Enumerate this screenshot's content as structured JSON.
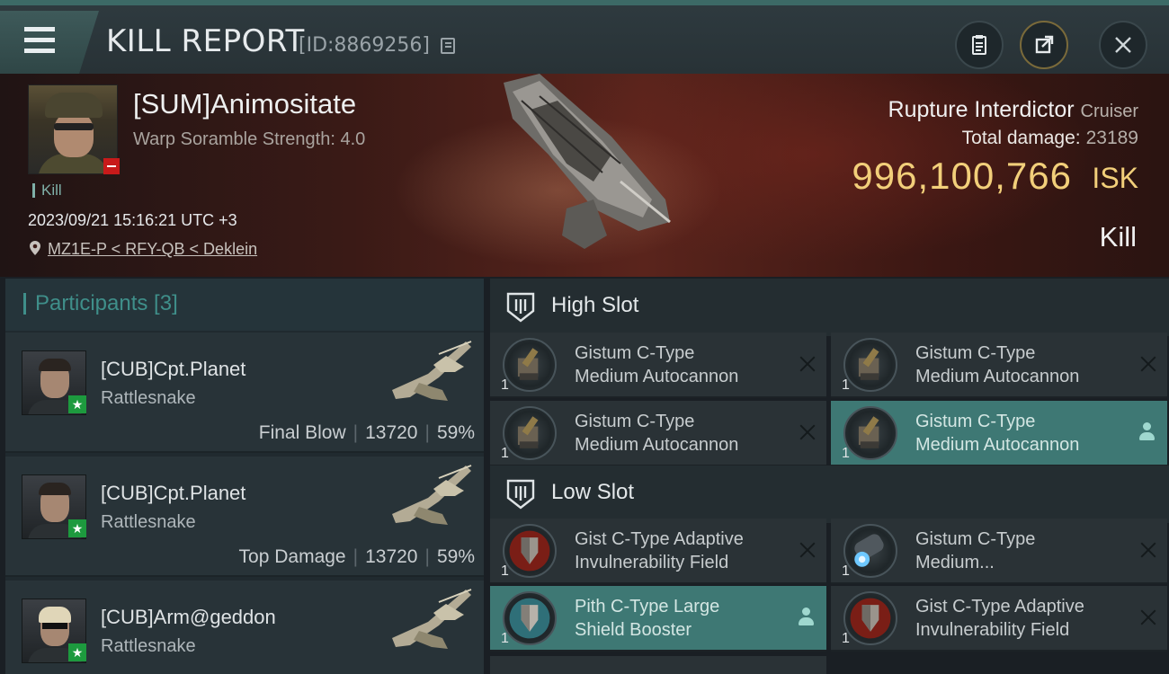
{
  "topbar": {
    "title": "KILL REPORT",
    "report_id": "[ID:8869256]",
    "icons": [
      "menu-icon",
      "copy-icon",
      "clipboard-icon",
      "share-icon",
      "close-icon"
    ]
  },
  "victim": {
    "name": "[SUM]Animositate",
    "subtitle": "Warp Soramble Strength: 4.0",
    "tag": "Kill",
    "timestamp": "2023/09/21 15:16:21 UTC +3",
    "location": "MZ1E-P < RFY-QB < Deklein",
    "ship_name": "Rupture Interdictor",
    "ship_class": "Cruiser",
    "total_damage_label": "Total damage:",
    "total_damage": "23189",
    "isk_value": "996,100,766",
    "isk_unit": "ISK",
    "result": "Kill"
  },
  "participants": {
    "label": "Participants [3]",
    "rows": [
      {
        "name": "[CUB]Cpt.Planet",
        "ship": "Rattlesnake",
        "role": "Final Blow",
        "damage": "13720",
        "percent": "59%"
      },
      {
        "name": "[CUB]Cpt.Planet",
        "ship": "Rattlesnake",
        "role": "Top Damage",
        "damage": "13720",
        "percent": "59%"
      },
      {
        "name": "[CUB]Arm@geddon",
        "ship": "Rattlesnake",
        "role": "",
        "damage": "",
        "percent": ""
      }
    ]
  },
  "fitting": {
    "high_slot": {
      "label": "High Slot",
      "modules": [
        {
          "line1": "Gistum C-Type",
          "line2": "Medium Autocannon",
          "qty": "1",
          "state": "destroyed"
        },
        {
          "line1": "Gistum C-Type",
          "line2": "Medium Autocannon",
          "qty": "1",
          "state": "destroyed"
        },
        {
          "line1": "Gistum C-Type",
          "line2": "Medium Autocannon",
          "qty": "1",
          "state": "destroyed"
        },
        {
          "line1": "Gistum C-Type",
          "line2": "Medium Autocannon",
          "qty": "1",
          "state": "dropped"
        }
      ]
    },
    "low_slot": {
      "label": "Low Slot",
      "modules": [
        {
          "line1": "Gist C-Type Adaptive",
          "line2": "Invulnerability Field",
          "qty": "1",
          "state": "destroyed"
        },
        {
          "line1": "Gistum C-Type",
          "line2": "Medium...",
          "qty": "1",
          "state": "destroyed"
        },
        {
          "line1": "Pith C-Type Large",
          "line2": "Shield Booster",
          "qty": "1",
          "state": "dropped"
        },
        {
          "line1": "Gist C-Type Adaptive",
          "line2": "Invulnerability Field",
          "qty": "1",
          "state": "destroyed"
        }
      ]
    }
  },
  "colors": {
    "accent": "#3e7874",
    "isk": "#f2cf7a",
    "hostile_badge": "#c81a1a",
    "friendly_badge": "#1d9a3e"
  }
}
